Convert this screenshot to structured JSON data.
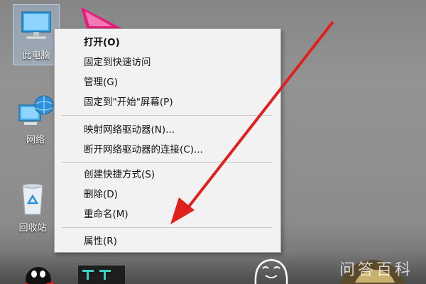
{
  "desktop": {
    "icons": [
      {
        "label": "此电脑",
        "icon": "this-pc-icon"
      },
      {
        "label": "网络",
        "icon": "network-icon"
      },
      {
        "label": "回收站",
        "icon": "recycle-bin-icon"
      }
    ]
  },
  "context_menu": {
    "groups": [
      [
        {
          "label": "打开(O)",
          "bold": true
        },
        {
          "label": "固定到快速访问"
        },
        {
          "label": "管理(G)"
        },
        {
          "label": "固定到\"开始\"屏幕(P)"
        }
      ],
      [
        {
          "label": "映射网络驱动器(N)..."
        },
        {
          "label": "断开网络驱动器的连接(C)..."
        }
      ],
      [
        {
          "label": "创建快捷方式(S)"
        },
        {
          "label": "删除(D)"
        },
        {
          "label": "重命名(M)"
        }
      ],
      [
        {
          "label": "属性(R)"
        }
      ]
    ]
  },
  "watermark": "问答百科",
  "colors": {
    "menu_bg": "#f2f2f2",
    "annotation_arrow": "#e0201c",
    "pointer_pink": "#e0207a",
    "selection": "#aac3e1"
  }
}
